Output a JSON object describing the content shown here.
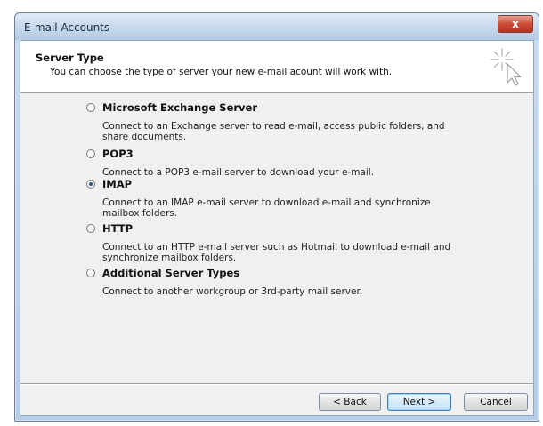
{
  "window": {
    "title": "E-mail Accounts",
    "close_label": "x"
  },
  "header": {
    "title": "Server Type",
    "subtitle": "You can choose the type of server your new e-mail acount will work with.",
    "icon": "cursor-sparkle-icon"
  },
  "options": [
    {
      "label": "Microsoft Exchange Server",
      "description": "Connect to an Exchange server to read e-mail, access public folders, and share documents.",
      "selected": false
    },
    {
      "label": "POP3",
      "description": "Connect to a POP3 e-mail server to download your e-mail.",
      "selected": false
    },
    {
      "label": "IMAP",
      "description": "Connect to an IMAP e-mail server to download e-mail and synchronize mailbox folders.",
      "selected": true
    },
    {
      "label": "HTTP",
      "description": "Connect to an HTTP e-mail server such as Hotmail to download e-mail and synchronize mailbox folders.",
      "selected": false
    },
    {
      "label": "Additional Server Types",
      "description": "Connect to another workgroup or 3rd-party mail server.",
      "selected": false
    }
  ],
  "buttons": {
    "back": "< Back",
    "next": "Next >",
    "cancel": "Cancel"
  },
  "colors": {
    "title_bar": "#c6d8ec",
    "close_button": "#cc4b35",
    "radio_selected": "#2b5a8f"
  }
}
